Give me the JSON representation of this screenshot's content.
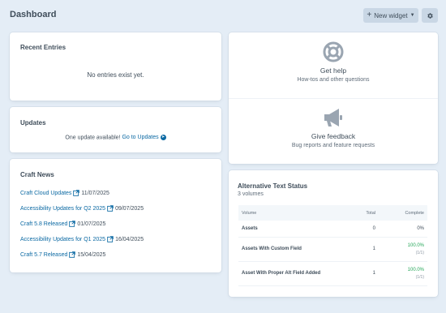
{
  "header": {
    "title": "Dashboard",
    "new_widget_label": "New widget"
  },
  "recent_entries": {
    "title": "Recent Entries",
    "empty_message": "No entries exist yet."
  },
  "updates": {
    "title": "Updates",
    "message": "One update available!",
    "link_label": "Go to Updates"
  },
  "craft_news": {
    "title": "Craft News",
    "items": [
      {
        "title": "Craft Cloud Updates",
        "date": "11/07/2025"
      },
      {
        "title": "Accessibility Updates for Q2 2025",
        "date": "09/07/2025"
      },
      {
        "title": "Craft 5.8 Released",
        "date": "01/07/2025"
      },
      {
        "title": "Accessibility Updates for Q1 2025",
        "date": "16/04/2025"
      },
      {
        "title": "Craft 5.7 Released",
        "date": "15/04/2025"
      }
    ]
  },
  "help": {
    "title": "Get help",
    "subtitle": "How-tos and other questions"
  },
  "feedback": {
    "title": "Give feedback",
    "subtitle": "Bug reports and feature requests"
  },
  "alt_text_status": {
    "title": "Alternative Text Status",
    "subtitle": "3 volumes",
    "columns": {
      "volume": "Volume",
      "total": "Total",
      "complete": "Complete"
    },
    "rows": [
      {
        "volume": "Assets",
        "total": "0",
        "complete": "0%",
        "fraction": ""
      },
      {
        "volume": "Assets With Custom Field",
        "total": "1",
        "complete": "100.0%",
        "fraction": "(1/1)"
      },
      {
        "volume": "Asset With Proper Alt Field Added",
        "total": "1",
        "complete": "100.0%",
        "fraction": "(1/1)"
      }
    ]
  },
  "colors": {
    "background": "#e4edf6",
    "link": "#0b69a3",
    "success": "#27a75a"
  }
}
